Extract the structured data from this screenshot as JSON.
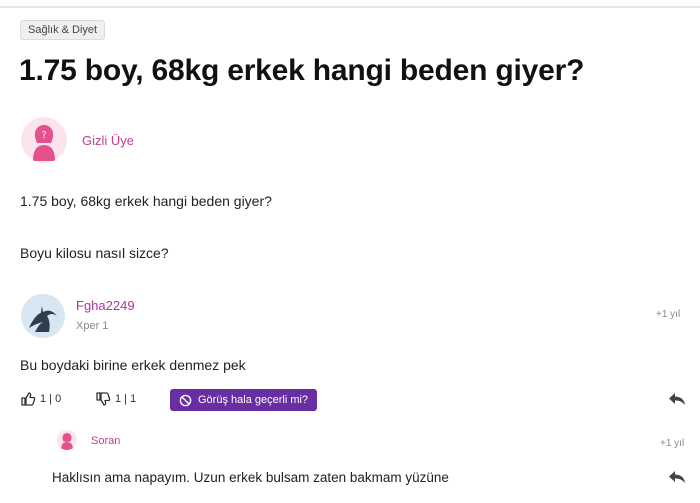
{
  "category": "Sağlık & Diyet",
  "question": {
    "title": "1.75 boy, 68kg erkek hangi beden giyer?",
    "author": "Gizli Üye",
    "body_line1": "1.75 boy, 68kg erkek hangi beden giyer?",
    "body_line2": "Boyu kilosu nasıl sizce?"
  },
  "answer": {
    "author": "Fgha2249",
    "level": "Xper 1",
    "time": "+1 yıl",
    "text": "Bu boydaki birine erkek denmez pek",
    "upvotes": "1 | 0",
    "downvotes": "1 | 1",
    "opinion_button": "Görüş hala geçerli mi?"
  },
  "reply": {
    "author": "Soran",
    "time": "+1 yıl",
    "text": "Haklısın ama napayım. Uzun erkek bulsam zaten bakmam yüzüne"
  },
  "colors": {
    "accent_pink": "#c2408f",
    "button_purple": "#6a2ea3"
  },
  "icons": {
    "author_avatar": "female-silhouette-icon",
    "answer_avatar": "user-avatar-icon",
    "upvote": "thumbs-up-icon",
    "downvote": "thumbs-down-icon",
    "opinion": "prohibited-circle-icon",
    "reply": "reply-arrow-icon"
  }
}
